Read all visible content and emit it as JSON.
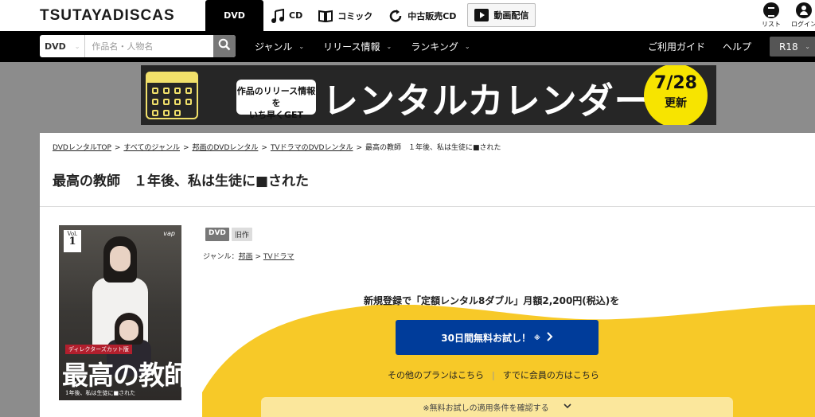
{
  "header": {
    "logo": "TSUTAYADISCAS",
    "categories": [
      {
        "label": "DVD",
        "active": true,
        "icon": "none"
      },
      {
        "label": "CD",
        "icon": "music-note-icon"
      },
      {
        "label": "コミック",
        "icon": "book-icon"
      },
      {
        "label": "中古販売CD",
        "icon": "refresh-icon"
      },
      {
        "label": "動画配信",
        "icon": "video-play-icon"
      }
    ],
    "list_label": "リスト",
    "login_label": "ログイン"
  },
  "nav": {
    "search_select": "DVD",
    "search_placeholder": "作品名・人物名",
    "menu": [
      "ジャンル",
      "リリース情報",
      "ランキング"
    ],
    "right_menu": [
      "ご利用ガイド",
      "ヘルプ"
    ],
    "r18_label": "R18"
  },
  "banner": {
    "bubble_line1": "作品のリリース情報を",
    "bubble_line2": "いち早くGET",
    "headline": "レンタルカレンダー",
    "date": "7/28",
    "date_sub": "更新",
    "accent": "#f7e400"
  },
  "breadcrumbs": [
    "DVDレンタルTOP",
    "すべてのジャンル",
    "邦画のDVDレンタル",
    "TVドラマのDVDレンタル",
    "最高の教師　１年後、私は生徒に■された"
  ],
  "product": {
    "title": "最高の教師　１年後、私は生徒に■された",
    "badges": [
      "DVD",
      "旧作"
    ],
    "genre_label": "ジャンル：",
    "genres": [
      "邦画",
      "TVドラマ"
    ],
    "poster": {
      "vol_label": "Vol.",
      "vol_number": "1",
      "label_tag": "ディレクターズカット版",
      "title": "最高の教師",
      "subtitle": "1年後、私は生徒に■された",
      "brand": "vap"
    }
  },
  "promo": {
    "lead": "新規登録で「定額レンタル8ダブル」月額2,200円(税込)を",
    "cta_label": "30日間無料お試し！",
    "cta_note": "※",
    "other_plans": "その他のプランはこちら",
    "member_link": "すでに会員の方はこちら",
    "conditions": "※無料お試しの適用条件を確認する",
    "cta_color": "#003c9a",
    "wave_color": "#f7c928"
  }
}
